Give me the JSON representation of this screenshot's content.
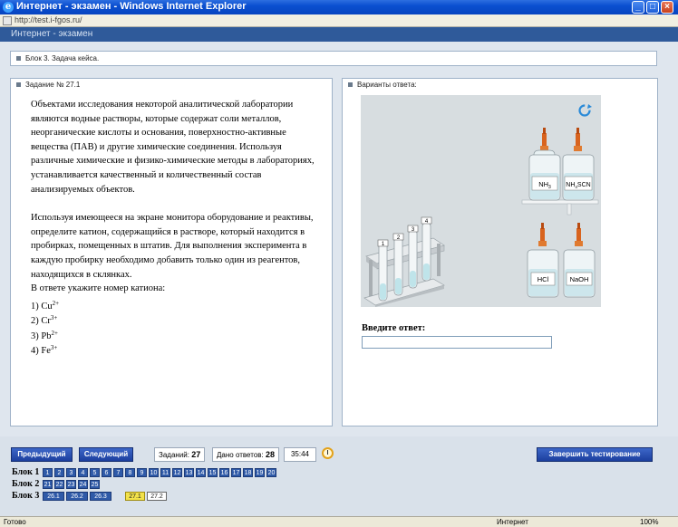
{
  "window": {
    "title": "Интернет - экзамен - Windows Internet Explorer",
    "url": "http://test.i-fgos.ru/"
  },
  "app": {
    "header": "Интернет - экзамен"
  },
  "block_heading": "Блок 3. Задача кейса.",
  "task": {
    "label": "Задание № 27.1",
    "paragraph1": "Объектами исследования некоторой аналитической лаборатории являются водные растворы, которые содержат соли металлов, неорганические кислоты и основания, поверхностно-активные вещества (ПАВ) и другие химические соединения. Используя различные химические и физико-химические методы в лабораториях, устанавливается качественный и количественный состав анализируемых объектов.",
    "paragraph2": "Используя имеющееся на экране монитора оборудование и реактивы, определите катион, содержащийся в растворе, который находится в пробирках, помещенных в штатив. Для выполнения эксперимента в каждую пробирку необходимо добавить только один из реагентов, находящихся в склянках.",
    "prompt": "В ответе укажите номер катиона:",
    "options": [
      {
        "num": "1)",
        "ion": "Cu",
        "charge": "2+"
      },
      {
        "num": "2)",
        "ion": "Cr",
        "charge": "3+"
      },
      {
        "num": "3)",
        "ion": "Pb",
        "charge": "2+"
      },
      {
        "num": "4)",
        "ion": "Fe",
        "charge": "3+"
      }
    ]
  },
  "answers": {
    "label": "Варианты ответа:",
    "input_label": "Введите ответ:",
    "input_value": "",
    "tube_numbers": [
      "1",
      "2",
      "3",
      "4"
    ],
    "bottles": [
      {
        "base": "NH",
        "sub": "3",
        "tail": ""
      },
      {
        "base": "NH",
        "sub": "4",
        "tail": "SCN"
      },
      {
        "base": "HCl",
        "sub": "",
        "tail": ""
      },
      {
        "base": "NaOH",
        "sub": "",
        "tail": ""
      }
    ]
  },
  "toolbar": {
    "prev": "Предыдущий",
    "next": "Следующий",
    "tasks_label": "Заданий:",
    "tasks_value": "27",
    "answers_label": "Дано ответов:",
    "answers_value": "28",
    "timer": "35:44",
    "finish": "Завершить тестирование"
  },
  "blocks": [
    {
      "label": "Блок 1",
      "items": [
        "1",
        "2",
        "3",
        "4",
        "5",
        "6",
        "7",
        "8",
        "9",
        "10",
        "11",
        "12",
        "13",
        "14",
        "15",
        "16",
        "17",
        "18",
        "19",
        "20"
      ]
    },
    {
      "label": "Блок 2",
      "items": [
        "21",
        "22",
        "23",
        "24",
        "25"
      ]
    },
    {
      "label": "Блок 3",
      "items": [
        "26.1",
        "26.2",
        "26.3",
        "27.1",
        "27.2"
      ]
    }
  ],
  "statusbar": {
    "left": "Готово",
    "zone": "Интернет",
    "zoom": "100%"
  },
  "colors": {
    "header": "#2f5a9a",
    "button": "#2f5aa8",
    "current": "#f3e24a"
  }
}
